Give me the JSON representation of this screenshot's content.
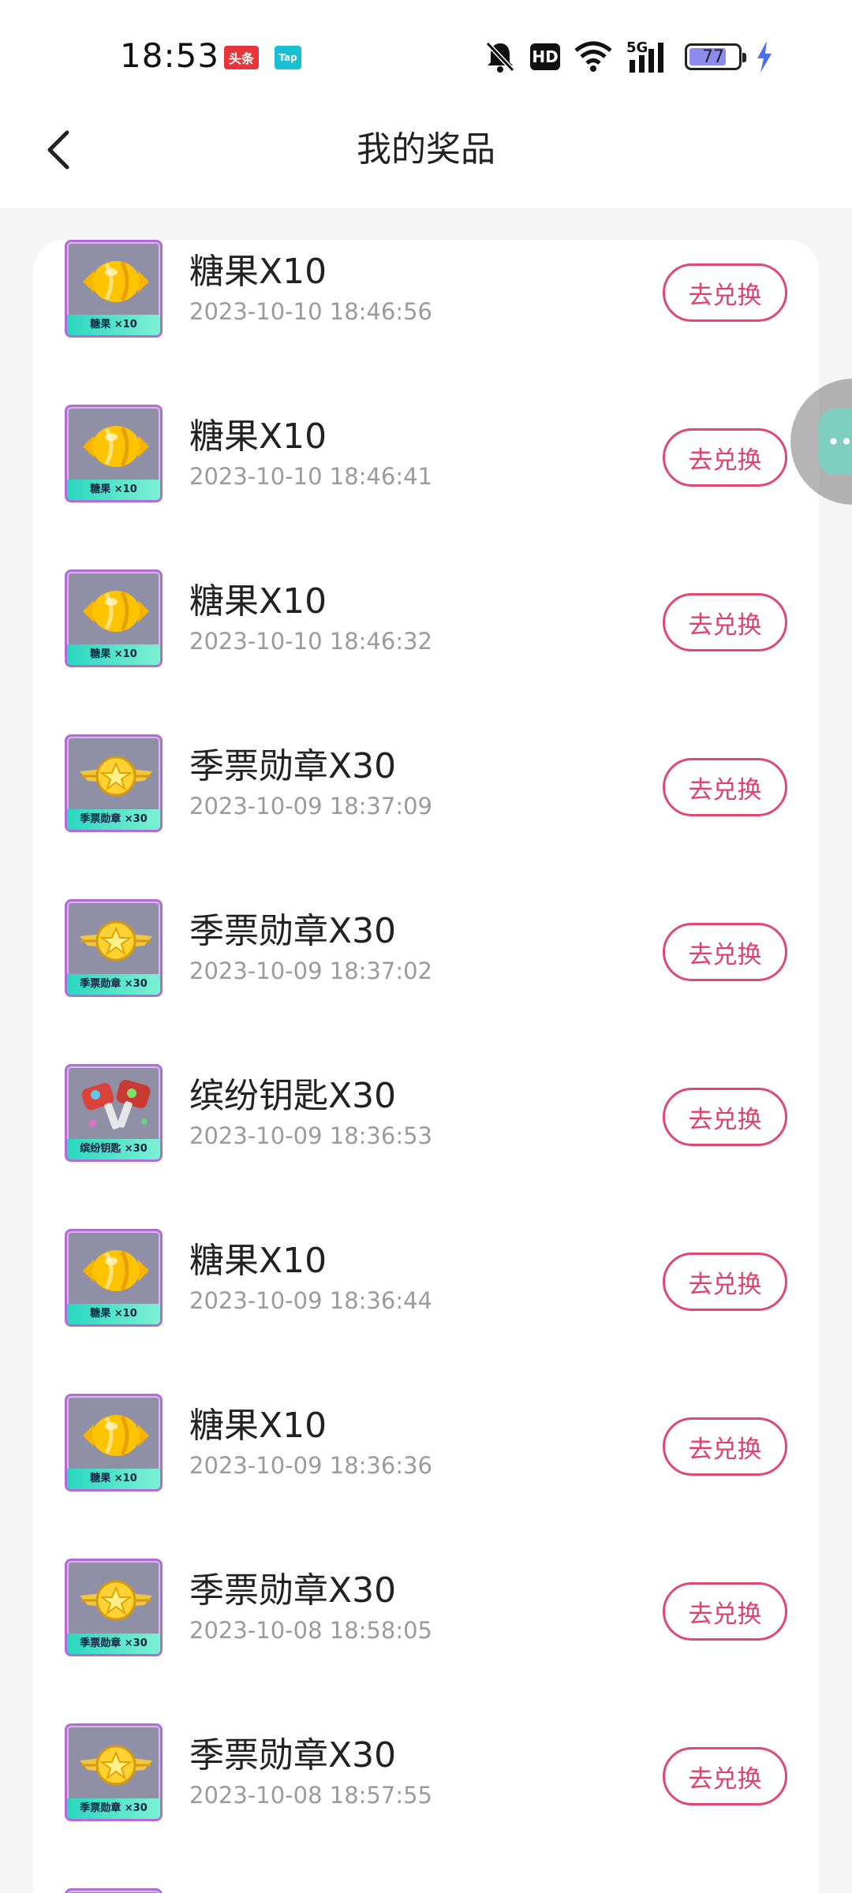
{
  "status_bar": {
    "time": "18:53",
    "badge_toutiao": "头条",
    "badge_tap": "Tap",
    "hd": "HD",
    "network": "5G",
    "battery": "77",
    "icons": [
      "bell-off-icon",
      "hd-icon",
      "wifi-icon",
      "signal-icon",
      "battery-icon",
      "charging-icon"
    ]
  },
  "header": {
    "title": "我的奖品",
    "back_icon": "chevron-left-icon"
  },
  "redeem_label": "去兑换",
  "prizes": [
    {
      "name": "糖果X10",
      "time": "2023-10-10 18:46:56",
      "kind": "candy",
      "thumb_label": "糖果 ×10"
    },
    {
      "name": "糖果X10",
      "time": "2023-10-10 18:46:41",
      "kind": "candy",
      "thumb_label": "糖果 ×10"
    },
    {
      "name": "糖果X10",
      "time": "2023-10-10 18:46:32",
      "kind": "candy",
      "thumb_label": "糖果 ×10"
    },
    {
      "name": "季票勋章X30",
      "time": "2023-10-09 18:37:09",
      "kind": "medal",
      "thumb_label": "季票勋章 ×30"
    },
    {
      "name": "季票勋章X30",
      "time": "2023-10-09 18:37:02",
      "kind": "medal",
      "thumb_label": "季票勋章 ×30"
    },
    {
      "name": "缤纷钥匙X30",
      "time": "2023-10-09 18:36:53",
      "kind": "key",
      "thumb_label": "缤纷钥匙 ×30"
    },
    {
      "name": "糖果X10",
      "time": "2023-10-09 18:36:44",
      "kind": "candy",
      "thumb_label": "糖果 ×10"
    },
    {
      "name": "糖果X10",
      "time": "2023-10-09 18:36:36",
      "kind": "candy",
      "thumb_label": "糖果 ×10"
    },
    {
      "name": "季票勋章X30",
      "time": "2023-10-08 18:58:05",
      "kind": "medal",
      "thumb_label": "季票勋章 ×30"
    },
    {
      "name": "季票勋章X30",
      "time": "2023-10-08 18:57:55",
      "kind": "medal",
      "thumb_label": "季票勋章 ×30"
    }
  ],
  "colors": {
    "accent": "#e0406b",
    "thumb_border": "#b36bd8",
    "thumb_label": "#2ad7c0"
  }
}
